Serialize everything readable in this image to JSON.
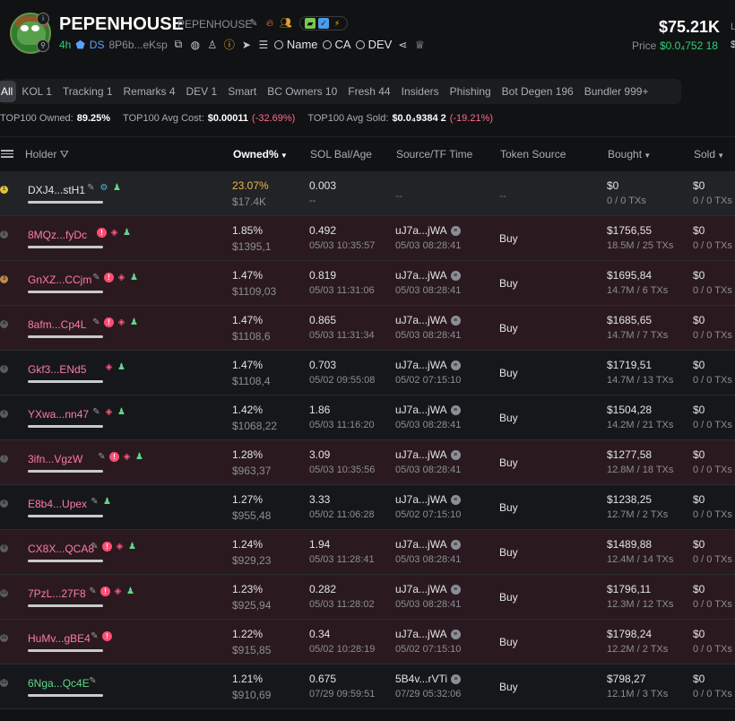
{
  "token": {
    "name": "PEPENHOUSE",
    "symbol": "PEPENHOUSE",
    "age": "4h",
    "ds_label": "DS",
    "address": "8P6b...eKsp",
    "search_name": "Name",
    "search_ca": "CA",
    "search_dev": "DEV",
    "market_cap": "$75.21K",
    "price_label": "Price",
    "price_value": "$0.0₄752 18",
    "edge_l": "L",
    "edge_s": "$"
  },
  "tabs": [
    "All",
    "KOL 1",
    "Tracking 1",
    "Remarks 4",
    "DEV 1",
    "Smart",
    "BC Owners 10",
    "Fresh 44",
    "Insiders",
    "Phishing",
    "Bot Degen 196",
    "Bundler 999+"
  ],
  "summary": {
    "owned_label": "TOP100 Owned:",
    "owned_value": "89.25%",
    "avg_cost_label": "TOP100 Avg Cost:",
    "avg_cost_value": "$0.00011",
    "avg_cost_change": "(-32.69%)",
    "avg_sold_label": "TOP100 Avg Sold:",
    "avg_sold_value": "$0.0₄9384 2",
    "avg_sold_change": "(-19.21%)"
  },
  "columns": {
    "holder": "Holder",
    "owned": "Owned%",
    "sol_bal": "SOL Bal/Age",
    "source": "Source/TF Time",
    "token_source": "Token Source",
    "bought": "Bought",
    "sold": "Sold"
  },
  "rows": [
    {
      "rank": "1",
      "holder": "DXJ4...stH1",
      "owned": "23.07%",
      "owned_usd": "$17.4K",
      "sol": "0.003",
      "age": "--",
      "source": "--",
      "tf_time": "",
      "token_source": "--",
      "bought": "$0",
      "bought_sub": "0 / 0 TXs",
      "sold": "$0",
      "sold_sub": "0 / 0 TXs"
    },
    {
      "rank": "2",
      "holder": "8MQz...fyDc",
      "owned": "1.85%",
      "owned_usd": "$1395,1",
      "sol": "0.492",
      "age": "05/03 10:35:57",
      "source": "uJ7a...jWA",
      "tf_time": "05/03 08:28:41",
      "token_source": "Buy",
      "bought": "$1756,55",
      "bought_sub": "18.5M / 25 TXs",
      "sold": "$0",
      "sold_sub": "0 / 0 TXs"
    },
    {
      "rank": "3",
      "holder": "GnXZ...CCjm",
      "owned": "1.47%",
      "owned_usd": "$1109,03",
      "sol": "0.819",
      "age": "05/03 11:31:06",
      "source": "uJ7a...jWA",
      "tf_time": "05/03 08:28:41",
      "token_source": "Buy",
      "bought": "$1695,84",
      "bought_sub": "14.7M / 6 TXs",
      "sold": "$0",
      "sold_sub": "0 / 0 TXs"
    },
    {
      "rank": "4",
      "holder": "8afm...Cp4L",
      "owned": "1.47%",
      "owned_usd": "$1108,6",
      "sol": "0.865",
      "age": "05/03 11:31:34",
      "source": "uJ7a...jWA",
      "tf_time": "05/03 08:28:41",
      "token_source": "Buy",
      "bought": "$1685,65",
      "bought_sub": "14.7M / 7 TXs",
      "sold": "$0",
      "sold_sub": "0 / 0 TXs"
    },
    {
      "rank": "5",
      "holder": "Gkf3...ENd5",
      "owned": "1.47%",
      "owned_usd": "$1108,4",
      "sol": "0.703",
      "age": "05/02 09:55:08",
      "source": "uJ7a...jWA",
      "tf_time": "05/02 07:15:10",
      "token_source": "Buy",
      "bought": "$1719,51",
      "bought_sub": "14.7M / 13 TXs",
      "sold": "$0",
      "sold_sub": "0 / 0 TXs"
    },
    {
      "rank": "6",
      "holder": "YXwa...nn47",
      "owned": "1.42%",
      "owned_usd": "$1068,22",
      "sol": "1.86",
      "age": "05/03 11:16:20",
      "source": "uJ7a...jWA",
      "tf_time": "05/03 08:28:41",
      "token_source": "Buy",
      "bought": "$1504,28",
      "bought_sub": "14.2M / 21 TXs",
      "sold": "$0",
      "sold_sub": "0 / 0 TXs"
    },
    {
      "rank": "7",
      "holder": "3ifn...VgzW",
      "owned": "1.28%",
      "owned_usd": "$963,37",
      "sol": "3.09",
      "age": "05/03 10:35:56",
      "source": "uJ7a...jWA",
      "tf_time": "05/03 08:28:41",
      "token_source": "Buy",
      "bought": "$1277,58",
      "bought_sub": "12.8M / 18 TXs",
      "sold": "$0",
      "sold_sub": "0 / 0 TXs"
    },
    {
      "rank": "8",
      "holder": "E8b4...Upex",
      "owned": "1.27%",
      "owned_usd": "$955,48",
      "sol": "3.33",
      "age": "05/02 11:06:28",
      "source": "uJ7a...jWA",
      "tf_time": "05/02 07:15:10",
      "token_source": "Buy",
      "bought": "$1238,25",
      "bought_sub": "12.7M / 2 TXs",
      "sold": "$0",
      "sold_sub": "0 / 0 TXs"
    },
    {
      "rank": "9",
      "holder": "CX8X...QCA8",
      "owned": "1.24%",
      "owned_usd": "$929,23",
      "sol": "1.94",
      "age": "05/03 11:28:41",
      "source": "uJ7a...jWA",
      "tf_time": "05/03 08:28:41",
      "token_source": "Buy",
      "bought": "$1489,88",
      "bought_sub": "12.4M / 14 TXs",
      "sold": "$0",
      "sold_sub": "0 / 0 TXs"
    },
    {
      "rank": "10",
      "holder": "7PzL...27F8",
      "owned": "1.23%",
      "owned_usd": "$925,94",
      "sol": "0.282",
      "age": "05/03 11:28:02",
      "source": "uJ7a...jWA",
      "tf_time": "05/03 08:28:41",
      "token_source": "Buy",
      "bought": "$1796,11",
      "bought_sub": "12.3M / 12 TXs",
      "sold": "$0",
      "sold_sub": "0 / 0 TXs"
    },
    {
      "rank": "11",
      "holder": "HuMv...gBE4",
      "owned": "1.22%",
      "owned_usd": "$915,85",
      "sol": "0.34",
      "age": "05/02 10:28:19",
      "source": "uJ7a...jWA",
      "tf_time": "05/02 07:15:10",
      "token_source": "Buy",
      "bought": "$1798,24",
      "bought_sub": "12.2M / 2 TXs",
      "sold": "$0",
      "sold_sub": "0 / 0 TXs"
    },
    {
      "rank": "12",
      "holder": "6Nga...Qc4E",
      "owned": "1.21%",
      "owned_usd": "$910,69",
      "sol": "0.675",
      "age": "07/29 09:59:51",
      "source": "5B4v...rVTi",
      "tf_time": "07/29 05:32:06",
      "token_source": "Buy",
      "bought": "$798,27",
      "bought_sub": "12.1M / 3 TXs",
      "sold": "$0",
      "sold_sub": "0 / 0 TXs"
    }
  ]
}
